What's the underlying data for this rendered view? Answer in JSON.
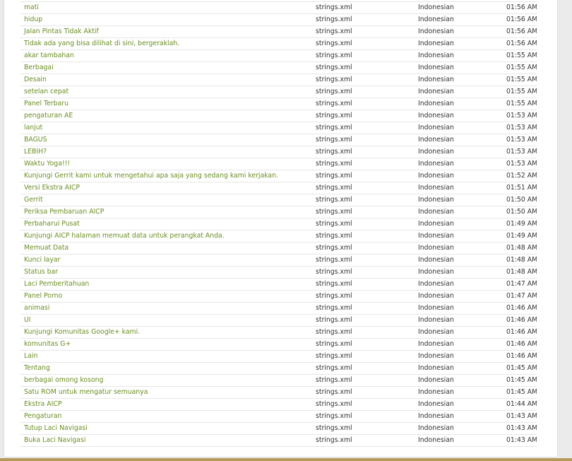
{
  "colors": {
    "link": "#6b8e23",
    "text": "#333333",
    "border": "#e6e6e6",
    "bottom_bar": "#b49a5a"
  },
  "rows": [
    {
      "string": "mati",
      "file": "strings.xml",
      "language": "Indonesian",
      "time": "01:56 AM"
    },
    {
      "string": "hidup",
      "file": "strings.xml",
      "language": "Indonesian",
      "time": "01:56 AM"
    },
    {
      "string": "Jalan Pintas Tidak Aktif",
      "file": "strings.xml",
      "language": "Indonesian",
      "time": "01:56 AM"
    },
    {
      "string": "Tidak ada yang bisa dilihat di sini, bergeraklah.",
      "file": "strings.xml",
      "language": "Indonesian",
      "time": "01:56 AM"
    },
    {
      "string": "akar tambahan",
      "file": "strings.xml",
      "language": "Indonesian",
      "time": "01:55 AM"
    },
    {
      "string": "Berbagai",
      "file": "strings.xml",
      "language": "Indonesian",
      "time": "01:55 AM"
    },
    {
      "string": "Desain",
      "file": "strings.xml",
      "language": "Indonesian",
      "time": "01:55 AM"
    },
    {
      "string": "setelan cepat",
      "file": "strings.xml",
      "language": "Indonesian",
      "time": "01:55 AM"
    },
    {
      "string": "Panel Terbaru",
      "file": "strings.xml",
      "language": "Indonesian",
      "time": "01:55 AM"
    },
    {
      "string": "pengaturan AE",
      "file": "strings.xml",
      "language": "Indonesian",
      "time": "01:53 AM"
    },
    {
      "string": "lanjut",
      "file": "strings.xml",
      "language": "Indonesian",
      "time": "01:53 AM"
    },
    {
      "string": "BAGUS",
      "file": "strings.xml",
      "language": "Indonesian",
      "time": "01:53 AM"
    },
    {
      "string": "LEBIH?",
      "file": "strings.xml",
      "language": "Indonesian",
      "time": "01:53 AM"
    },
    {
      "string": "Waktu Yoga!!!",
      "file": "strings.xml",
      "language": "Indonesian",
      "time": "01:53 AM"
    },
    {
      "string": "Kunjungi Gerrit kami untuk mengetahui apa saja yang sedang kami kerjakan.",
      "file": "strings.xml",
      "language": "Indonesian",
      "time": "01:52 AM"
    },
    {
      "string": "Versi Ekstra AICP",
      "file": "strings.xml",
      "language": "Indonesian",
      "time": "01:51 AM"
    },
    {
      "string": "Gerrit",
      "file": "strings.xml",
      "language": "Indonesian",
      "time": "01:50 AM"
    },
    {
      "string": "Periksa Pembaruan AICP",
      "file": "strings.xml",
      "language": "Indonesian",
      "time": "01:50 AM"
    },
    {
      "string": "Perbaharui Pusat",
      "file": "strings.xml",
      "language": "Indonesian",
      "time": "01:49 AM"
    },
    {
      "string": "Kunjungi AICP halaman memuat data untuk perangkat Anda.",
      "file": "strings.xml",
      "language": "Indonesian",
      "time": "01:49 AM"
    },
    {
      "string": "Memuat Data",
      "file": "strings.xml",
      "language": "Indonesian",
      "time": "01:48 AM"
    },
    {
      "string": "Kunci layar",
      "file": "strings.xml",
      "language": "Indonesian",
      "time": "01:48 AM"
    },
    {
      "string": "Status bar",
      "file": "strings.xml",
      "language": "Indonesian",
      "time": "01:48 AM"
    },
    {
      "string": "Laci Pemberitahuan",
      "file": "strings.xml",
      "language": "Indonesian",
      "time": "01:47 AM"
    },
    {
      "string": "Panel Porno",
      "file": "strings.xml",
      "language": "Indonesian",
      "time": "01:47 AM"
    },
    {
      "string": "animasi",
      "file": "strings.xml",
      "language": "Indonesian",
      "time": "01:46 AM"
    },
    {
      "string": "UI",
      "file": "strings.xml",
      "language": "Indonesian",
      "time": "01:46 AM"
    },
    {
      "string": "Kunjungi Komunitas Google+ kami.",
      "file": "strings.xml",
      "language": "Indonesian",
      "time": "01:46 AM"
    },
    {
      "string": "komunitas G+",
      "file": "strings.xml",
      "language": "Indonesian",
      "time": "01:46 AM"
    },
    {
      "string": "Lain",
      "file": "strings.xml",
      "language": "Indonesian",
      "time": "01:46 AM"
    },
    {
      "string": "Tentang",
      "file": "strings.xml",
      "language": "Indonesian",
      "time": "01:45 AM"
    },
    {
      "string": "berbagai omong kosong",
      "file": "strings.xml",
      "language": "Indonesian",
      "time": "01:45 AM"
    },
    {
      "string": "Satu ROM untuk mengatur semuanya",
      "file": "strings.xml",
      "language": "Indonesian",
      "time": "01:45 AM"
    },
    {
      "string": "Ekstra AICP",
      "file": "strings.xml",
      "language": "Indonesian",
      "time": "01:44 AM"
    },
    {
      "string": "Pengaturan",
      "file": "strings.xml",
      "language": "Indonesian",
      "time": "01:43 AM"
    },
    {
      "string": "Tutup Laci Navigasi",
      "file": "strings.xml",
      "language": "Indonesian",
      "time": "01:43 AM"
    },
    {
      "string": "Buka Laci Navigasi",
      "file": "strings.xml",
      "language": "Indonesian",
      "time": "01:43 AM"
    }
  ]
}
